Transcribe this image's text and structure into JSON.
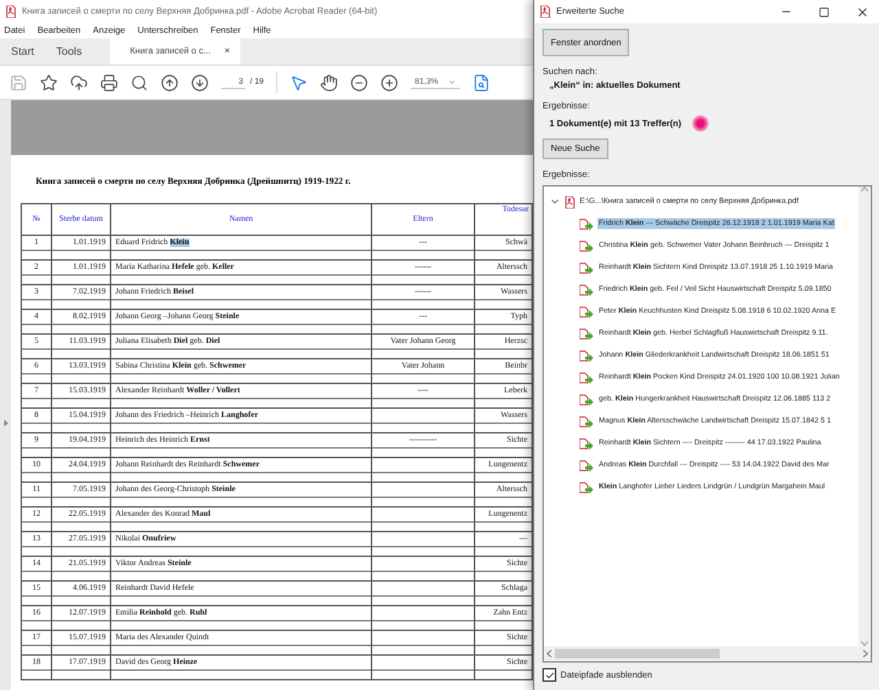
{
  "app_window": {
    "title": "Книга записей о смерти по селу Верхняя Добринка.pdf - Adobe Acrobat Reader (64-bit)",
    "menu": [
      "Datei",
      "Bearbeiten",
      "Anzeige",
      "Unterschreiben",
      "Fenster",
      "Hilfe"
    ],
    "tabs": [
      {
        "label": "Start",
        "selected": false
      },
      {
        "label": "Tools",
        "selected": false
      },
      {
        "label": "Книга записей о с...",
        "selected": true,
        "close": "×"
      }
    ],
    "toolbar": {
      "page_current": "3",
      "page_total": "/ 19",
      "zoom": "81,3%"
    }
  },
  "document": {
    "heading": "Книга записей о смерти по селу Верхняя Добринка (Дрейшпитц) 1919-1922 г.",
    "columns": [
      "№",
      "Sterbe datum",
      "Namen",
      "Eltern",
      "Todesur"
    ],
    "rows": [
      {
        "no": "1",
        "date": "1.01.1919",
        "name": "Eduard Fridrich",
        "highlight": "Klein",
        "parents": "---",
        "cause": "Schwä"
      },
      {
        "no": "2",
        "date": "1.01.1919",
        "name": "Maria Katharina  **Hefele** geb. **Keller**",
        "parents": "------",
        "cause": "Alterssch"
      },
      {
        "no": "3",
        "date": "7.02.1919",
        "name": "Johann Friedrich **Beisel**",
        "parents": "------",
        "cause": "Wassers"
      },
      {
        "no": "4",
        "date": "8.02.1919",
        "name": "Johann Georg –Johann  Georg  **Steinle**",
        "parents": "---",
        "cause": "Typh"
      },
      {
        "no": "5",
        "date": "11.03.1919",
        "name": "Juliana  Elisabeth **Diel** geb. **Diel**",
        "parents": "Vater Johann Georg",
        "cause": "Herzsc"
      },
      {
        "no": "6",
        "date": "13.03.1919",
        "name": "Sabina Christina **Klein** geb.  **Schwemer**",
        "parents": "Vater Johann",
        "cause": "Beinbr"
      },
      {
        "no": "7",
        "date": "15.03.1919",
        "name": "Alexander Reinhardt  **Woller / Vollert**",
        "parents": "----",
        "cause": "Leberk"
      },
      {
        "no": "8",
        "date": "15.04.1919",
        "name": "Johann des Friedrich –Heinrich  **Langhofer**",
        "cause": "Wassers"
      },
      {
        "no": "9",
        "date": "19.04.1919",
        "name": "Heinrich des Heinrich **Ernst**",
        "parents": "----------",
        "cause": "Sichte"
      },
      {
        "no": "10",
        "date": "24.04.1919",
        "name": "Johann Reinhardt des Reinhardt **Schwemer**",
        "cause": "Lungenentz"
      },
      {
        "no": "11",
        "date": "7.05.1919",
        "name": "Johann des Georg-Christoph  **Steinle**",
        "cause": "Alterssch"
      },
      {
        "no": "12",
        "date": "22.05.1919",
        "name": "Alexander des Konrad **Maul**",
        "cause": "Lungenentz"
      },
      {
        "no": "13",
        "date": "27.05.1919",
        "name": "Nikolai  **Onufriew**",
        "cause": "---"
      },
      {
        "no": "14",
        "date": "21.05.1919",
        "name": "Viktor Andreas  **Steinle**",
        "cause": "Sichte"
      },
      {
        "no": "15",
        "date": "4.06.1919",
        "name": "Reinhardt  David Hefele",
        "cause": "Schlaga"
      },
      {
        "no": "16",
        "date": "12.07.1919",
        "name": "Emilia **Reinhold** geb. **Ruhl**",
        "cause": "Zahn Entz"
      },
      {
        "no": "17",
        "date": "15.07.1919",
        "name": "Maria des Alexander Quindt",
        "cause": "Sichte"
      },
      {
        "no": "18",
        "date": "17.07.1919",
        "name": "David des Georg **Heinze**",
        "cause": "Sichte"
      }
    ]
  },
  "search_dialog": {
    "title": "Erweiterte Suche",
    "arrange_button": "Fenster anordnen",
    "search_label": "Suchen nach:",
    "search_query": "„Klein“ in: aktuelles Dokument",
    "results_label": "Ergebnisse:",
    "results_summary": "1 Dokument(e) mit 13 Treffer(n)",
    "new_search_button": "Neue Suche",
    "list_label": "Ergebnisse:",
    "file": {
      "path": "E:\\G...\\Книга записей о смерти по селу Верхняя Добринка.pdf",
      "expanded": true,
      "results": [
        {
          "text": "Fridrich **Klein** --- Schwäche Dreispitz 26.12.1918 2 1.01.1919 Maria Kat",
          "selected": true
        },
        {
          "text": "Christina **Klein** geb. Schwemer Vater Johann Beinbruch --- Dreispitz 1",
          "selected": false
        },
        {
          "text": "Reinhardt **Klein** Sichtern Kind Dreispitz 13.07.1918 25 1.10.1919 Maria",
          "selected": false
        },
        {
          "text": "Friedrich **Klein** geb. Feil / Veil Sicht Hauswirtschaft Dreispitz 5.09.1850",
          "selected": false
        },
        {
          "text": "Peter **Klein** Keuchhusten Kind Dreispitz 5.08.1918 6 10.02.1920 Anna E",
          "selected": false
        },
        {
          "text": "Reinhardt **Klein** geb. Herbel Schlagfluß Hauswirtschaft Dreispitz 9.11.",
          "selected": false
        },
        {
          "text": "Johann **Klein** Gliederkrankheit Landwirtschaft Dreispitz 18.06.1851 51",
          "selected": false
        },
        {
          "text": "Reinhardt **Klein** Pocken Kind Dreispitz 24.01.1920 100 10.08.1921 Julian",
          "selected": false
        },
        {
          "text": "geb. **Klein** Hungerkrankheit Hauswirtschaft Dreispitz 12.06.1885 113 2",
          "selected": false
        },
        {
          "text": "Magnus **Klein** Altersschwäche Landwirtschaft Dreispitz 15.07.1842 5 1",
          "selected": false
        },
        {
          "text": "Reinhardt **Klein** Sichtern ---- Dreispitz -------- 44 17.03.1922 Paulina",
          "selected": false
        },
        {
          "text": "Andreas **Klein** Durchfall --- Dreispitz ---- 53 14.04.1922 David des Mar",
          "selected": false
        },
        {
          "text": "**Klein** Langhofer Lieber Lieders Lindgrün / Lundgrün Margahein Maul",
          "selected": false
        }
      ]
    },
    "hide_paths": {
      "label": "Dateipfade ausblenden",
      "checked": true
    }
  }
}
